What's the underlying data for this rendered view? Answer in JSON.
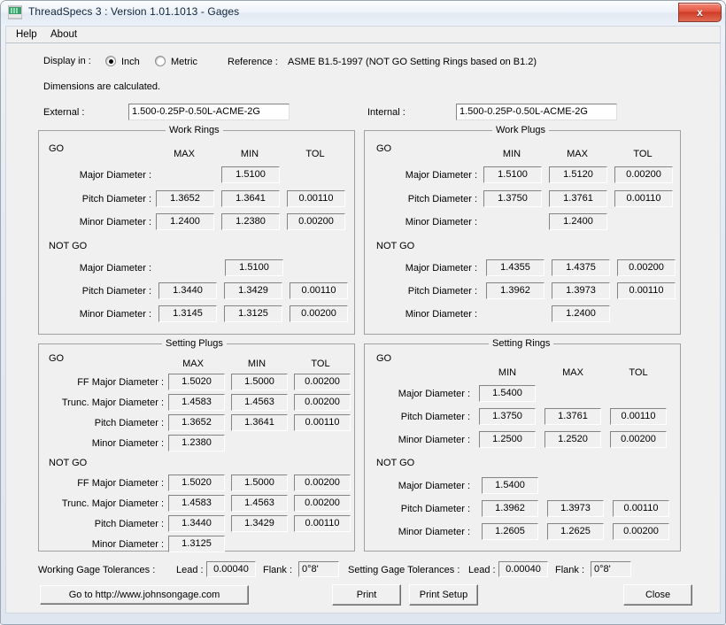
{
  "window": {
    "title": "ThreadSpecs 3 : Version 1.01.1013 - Gages",
    "close_label": "x",
    "icon_name": "app-icon"
  },
  "menu": {
    "items": [
      {
        "label": "Help"
      },
      {
        "label": "About"
      }
    ]
  },
  "options": {
    "display_in_label": "Display in :",
    "inch_label": "Inch",
    "metric_label": "Metric",
    "selected_unit": "Inch",
    "reference_label": "Reference :",
    "reference_value": "ASME B1.5-1997 (NOT GO Setting Rings based on B1.2)",
    "status_text": "Dimensions are calculated."
  },
  "thread": {
    "external_label": "External :",
    "external_value": "1.500-0.25P-0.50L-ACME-2G",
    "internal_label": "Internal :",
    "internal_value": "1.500-0.25P-0.50L-ACME-2G"
  },
  "common": {
    "go_label": "GO",
    "notgo_label": "NOT GO",
    "max_label": "MAX",
    "min_label": "MIN",
    "tol_label": "TOL",
    "major_label": "Major Diameter :",
    "pitch_label": "Pitch Diameter :",
    "minor_label": "Minor Diameter :",
    "ff_major_label": "FF Major Diameter :",
    "trunc_major_label": "Trunc. Major Diameter :"
  },
  "work_rings": {
    "title": "Work Rings",
    "col1": "MAX",
    "col2": "MIN",
    "col3": "TOL",
    "go": {
      "major": {
        "c1": "",
        "c2": "1.5100",
        "c3": ""
      },
      "pitch": {
        "c1": "1.3652",
        "c2": "1.3641",
        "c3": "0.00110"
      },
      "minor": {
        "c1": "1.2400",
        "c2": "1.2380",
        "c3": "0.00200"
      }
    },
    "notgo": {
      "major": {
        "c1": "",
        "c2": "1.5100",
        "c3": ""
      },
      "pitch": {
        "c1": "1.3440",
        "c2": "1.3429",
        "c3": "0.00110"
      },
      "minor": {
        "c1": "1.3145",
        "c2": "1.3125",
        "c3": "0.00200"
      }
    }
  },
  "work_plugs": {
    "title": "Work Plugs",
    "col1": "MIN",
    "col2": "MAX",
    "col3": "TOL",
    "go": {
      "major": {
        "c1": "1.5100",
        "c2": "1.5120",
        "c3": "0.00200"
      },
      "pitch": {
        "c1": "1.3750",
        "c2": "1.3761",
        "c3": "0.00110"
      },
      "minor": {
        "c1": "",
        "c2": "1.2400",
        "c3": ""
      }
    },
    "notgo": {
      "major": {
        "c1": "1.4355",
        "c2": "1.4375",
        "c3": "0.00200"
      },
      "pitch": {
        "c1": "1.3962",
        "c2": "1.3973",
        "c3": "0.00110"
      },
      "minor": {
        "c1": "",
        "c2": "1.2400",
        "c3": ""
      }
    }
  },
  "setting_plugs": {
    "title": "Setting Plugs",
    "col1": "MAX",
    "col2": "MIN",
    "col3": "TOL",
    "go": {
      "ff_major": {
        "c1": "1.5020",
        "c2": "1.5000",
        "c3": "0.00200"
      },
      "trunc_major": {
        "c1": "1.4583",
        "c2": "1.4563",
        "c3": "0.00200"
      },
      "pitch": {
        "c1": "1.3652",
        "c2": "1.3641",
        "c3": "0.00110"
      },
      "minor": {
        "c1": "1.2380",
        "c2": "",
        "c3": ""
      }
    },
    "notgo": {
      "ff_major": {
        "c1": "1.5020",
        "c2": "1.5000",
        "c3": "0.00200"
      },
      "trunc_major": {
        "c1": "1.4583",
        "c2": "1.4563",
        "c3": "0.00200"
      },
      "pitch": {
        "c1": "1.3440",
        "c2": "1.3429",
        "c3": "0.00110"
      },
      "minor": {
        "c1": "1.3125",
        "c2": "",
        "c3": ""
      }
    }
  },
  "setting_rings": {
    "title": "Setting Rings",
    "col1": "MIN",
    "col2": "MAX",
    "col3": "TOL",
    "go": {
      "major": {
        "c1": "1.5400",
        "c2": "",
        "c3": ""
      },
      "pitch": {
        "c1": "1.3750",
        "c2": "1.3761",
        "c3": "0.00110"
      },
      "minor": {
        "c1": "1.2500",
        "c2": "1.2520",
        "c3": "0.00200"
      }
    },
    "notgo": {
      "major": {
        "c1": "1.5400",
        "c2": "",
        "c3": ""
      },
      "pitch": {
        "c1": "1.3962",
        "c2": "1.3973",
        "c3": "0.00110"
      },
      "minor": {
        "c1": "1.2605",
        "c2": "1.2625",
        "c3": "0.00200"
      }
    }
  },
  "tolerances": {
    "working_label": "Working Gage Tolerances :",
    "setting_label": "Setting Gage Tolerances :",
    "lead_label": "Lead :",
    "flank_label": "Flank :",
    "working_lead": "0.00040",
    "working_flank": "0°8'",
    "setting_lead": "0.00040",
    "setting_flank": "0°8'"
  },
  "buttons": {
    "website": "Go to http://www.johnsongage.com",
    "print": "Print",
    "print_setup": "Print Setup",
    "close": "Close"
  }
}
